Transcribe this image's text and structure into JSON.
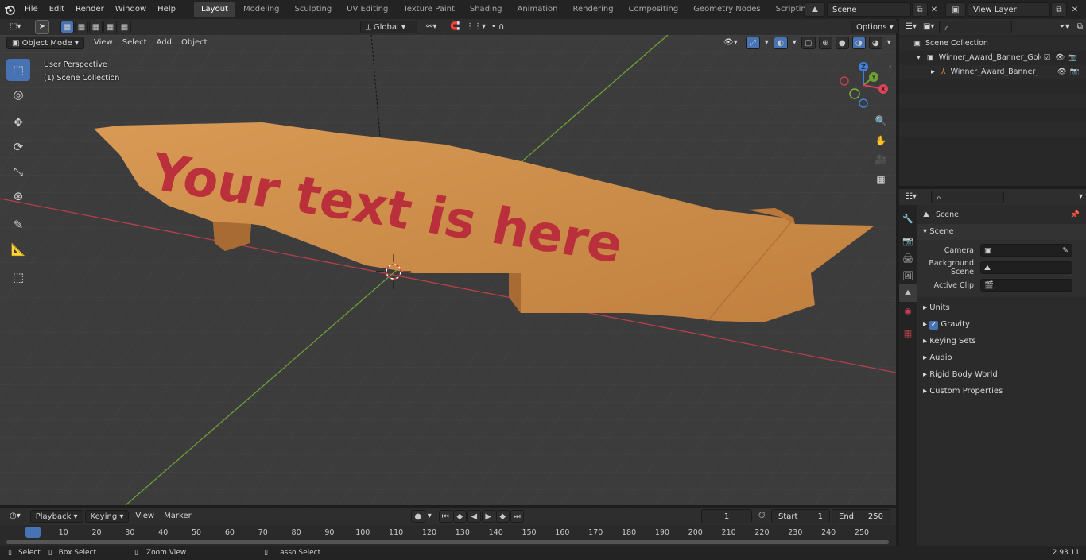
{
  "topbar": {
    "menu": [
      "File",
      "Edit",
      "Render",
      "Window",
      "Help"
    ],
    "workspaces": [
      "Layout",
      "Modeling",
      "Sculpting",
      "UV Editing",
      "Texture Paint",
      "Shading",
      "Animation",
      "Rendering",
      "Compositing",
      "Geometry Nodes",
      "Scripting"
    ],
    "active_workspace": "Layout",
    "add_tab": "+",
    "scene_name": "Scene",
    "view_layer": "View Layer"
  },
  "viewport_header": {
    "mode": "Object Mode",
    "menus": [
      "View",
      "Select",
      "Add",
      "Object"
    ],
    "orientation": "Global",
    "options": "Options"
  },
  "viewport": {
    "view_name": "User Perspective",
    "collection": "(1) Scene Collection",
    "banner_text": "Your text is here",
    "gizmo_labels": {
      "x": "X",
      "y": "Y",
      "z": "Z"
    }
  },
  "outliner": {
    "root": "Scene Collection",
    "items": [
      {
        "label": "Winner_Award_Banner_Gold_"
      },
      {
        "label": "Winner_Award_Banner_C"
      }
    ]
  },
  "properties": {
    "context": "Scene",
    "section": "Scene",
    "fields": [
      {
        "label": "Camera"
      },
      {
        "label": "Background Scene"
      },
      {
        "label": "Active Clip"
      }
    ],
    "panels": [
      "Units",
      "Gravity",
      "Keying Sets",
      "Audio",
      "Rigid Body World",
      "Custom Properties"
    ],
    "gravity_checked": true
  },
  "timeline": {
    "menus": [
      "Playback",
      "Keying",
      "View",
      "Marker"
    ],
    "current_frame": "1",
    "start_label": "Start",
    "start": "1",
    "end_label": "End",
    "end": "250",
    "ticks": [
      "1",
      "10",
      "20",
      "30",
      "40",
      "50",
      "60",
      "70",
      "80",
      "90",
      "100",
      "110",
      "120",
      "130",
      "140",
      "150",
      "160",
      "170",
      "180",
      "190",
      "200",
      "210",
      "220",
      "230",
      "240",
      "250"
    ]
  },
  "statusbar": {
    "items": [
      "Select",
      "Box Select",
      "Zoom View",
      "Lasso Select"
    ],
    "version": "2.93.11"
  },
  "colors": {
    "accent": "#4772b3",
    "banner": "#c98a4a",
    "banner_text": "#b8283a",
    "axis_x": "#b5404a",
    "axis_y": "#6ea135"
  }
}
